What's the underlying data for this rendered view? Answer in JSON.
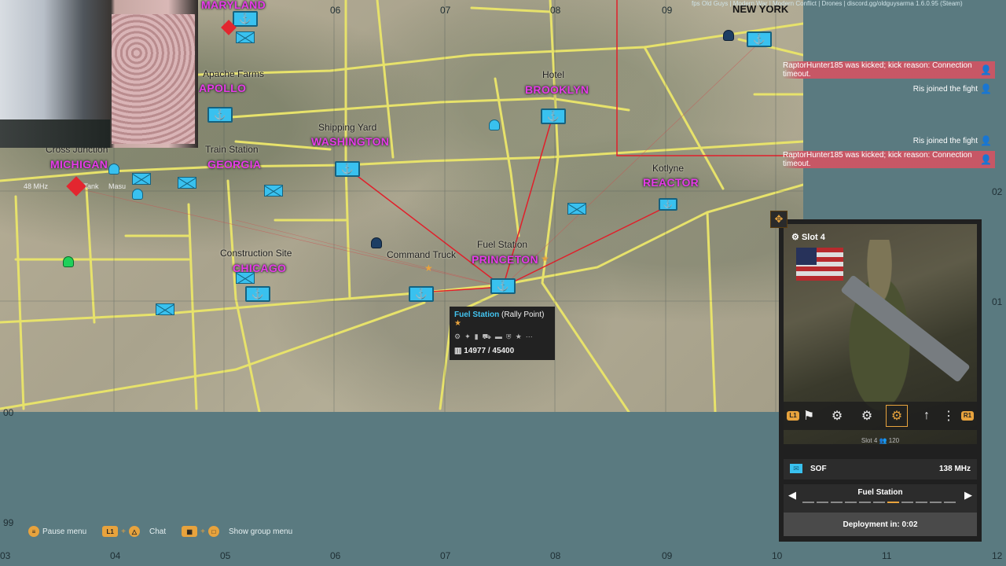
{
  "map": {
    "grid_top": [
      "06",
      "07",
      "08",
      "09"
    ],
    "grid_bottom": [
      "04",
      "05",
      "06",
      "07",
      "08",
      "09",
      "10",
      "11",
      "12"
    ],
    "grid_left": [
      "00",
      "99",
      "03"
    ],
    "grid_right": [
      "02",
      "01"
    ],
    "towns": [
      "MARYLAND",
      "APOLLO",
      "BROOKLYN",
      "WASHINGTON",
      "MICHIGAN",
      "GEORGIA",
      "REACTOR",
      "PRINCETON",
      "CHICAGO"
    ],
    "places": [
      "Hotel",
      "Shipping Yard",
      "Cross Junction",
      "Train Station",
      "Kotlyne",
      "Fuel Station",
      "Construction Site",
      "Command Truck"
    ],
    "partial": [
      "Apache Farms",
      "48 MHz",
      "Anti-Tank",
      "Masu"
    ],
    "new_york": "NEW YORK"
  },
  "hud_top": "fps  Old Guys | Modern War | Modern Conflict | Drones | discord.gg/oldguysarma     1.6.0.95 (Steam)",
  "notifications": [
    {
      "text": "RaptorHunter185 was kicked; kick reason: Connection timeout.",
      "style": "red"
    },
    {
      "text": "Ris joined the fight",
      "style": "plain"
    },
    {
      "text": "Ris joined the fight",
      "style": "plain"
    },
    {
      "text": "RaptorHunter185 was kicked; kick reason: Connection timeout.",
      "style": "red"
    }
  ],
  "tooltip": {
    "name": "Fuel Station",
    "type": "(Rally Point)",
    "supply": "14977 / 45400"
  },
  "panel": {
    "slot_title": "Slot 4",
    "slot_info": "Slot 4",
    "slot_count": "120",
    "radio_name": "SOF",
    "radio_freq": "138 MHz",
    "spawn_name": "Fuel Station",
    "deploy": "Deployment in: 0:02",
    "lb": "L1",
    "rb": "R1"
  },
  "bottom": {
    "pause": "Pause menu",
    "chat": "Chat",
    "group": "Show group menu",
    "l1": "L1"
  },
  "colors": {
    "ocean": "#5a7a80",
    "marker": "#39c1ef",
    "town": "#e63be8",
    "accent": "#e8a33d"
  }
}
